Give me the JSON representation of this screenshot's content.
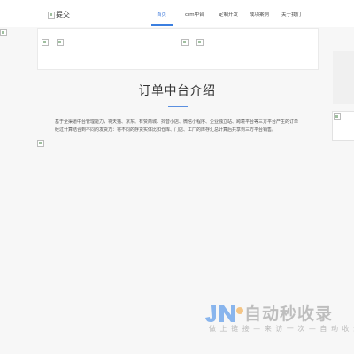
{
  "header": {
    "logo_alt": "提交",
    "nav": [
      {
        "label": "首页",
        "active": true
      },
      {
        "label": "crm中台",
        "active": false
      },
      {
        "label": "定制开发",
        "active": false
      },
      {
        "label": "成功案例",
        "active": false
      },
      {
        "label": "关于我们",
        "active": false
      }
    ]
  },
  "section": {
    "title": "订单中台介绍",
    "description": "基于全渠道中台管理能力，将天猫、京东、有赞商城、抖音小店、微信小程序、企业独立站、跨境平台等三方平台产生的订单经过计算结合到不同的发货方：将不同的存货实体比如仓库、门店、工厂的库存汇总计算后共享到三方平台销售。"
  },
  "watermark": {
    "brand": "自动秒收录",
    "slogan": "做 上 链 接 — 来 访 一 次 — 自 动 收 录",
    "accent_color": "#2f7fe6"
  }
}
